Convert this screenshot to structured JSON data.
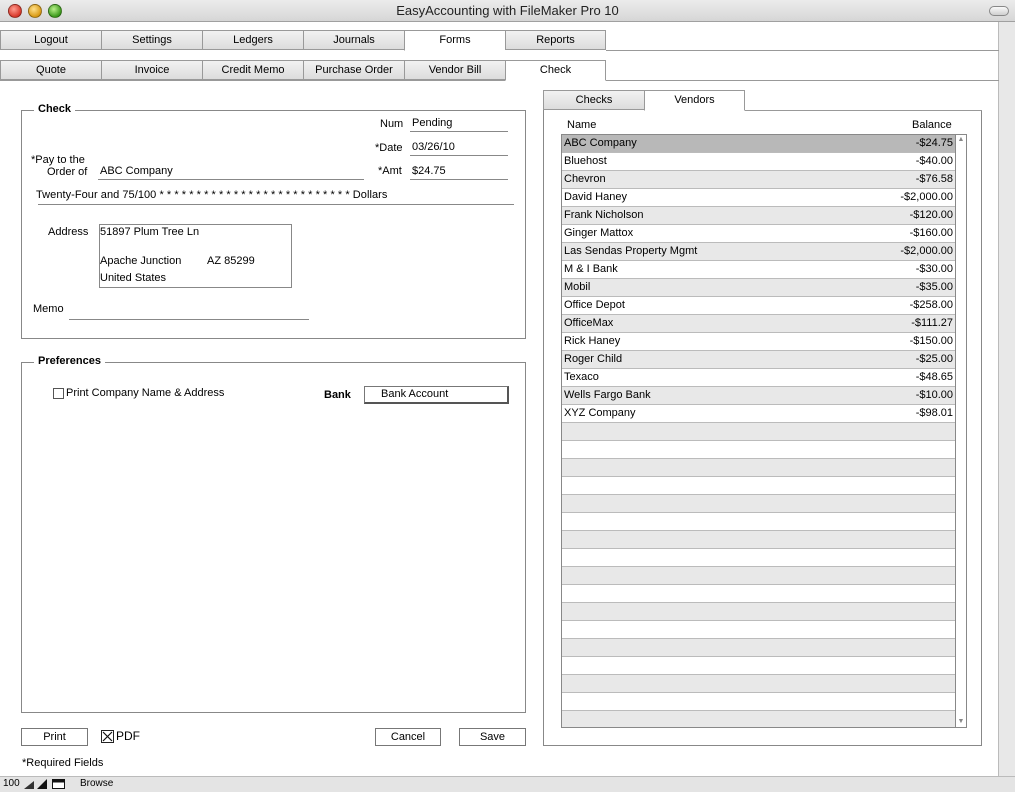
{
  "window": {
    "title": "EasyAccounting with FileMaker Pro 10"
  },
  "main_tabs": [
    "Logout",
    "Settings",
    "Ledgers",
    "Journals",
    "Forms",
    "Reports"
  ],
  "sub_tabs": [
    "Quote",
    "Invoice",
    "Credit Memo",
    "Purchase Order",
    "Vendor Bill",
    "Check"
  ],
  "check": {
    "legend": "Check",
    "num_label": "Num",
    "num_value": "Pending",
    "date_label": "*Date",
    "date_value": "03/26/10",
    "pay_to_label_1": "*Pay to the",
    "pay_to_label_2": "Order of",
    "pay_to_value": "ABC Company",
    "amt_label": "*Amt",
    "amt_value": "$24.75",
    "amount_words": "Twenty-Four and 75/100 * * * * * * * * * * * * * * * * * * * * * * * * * * Dollars",
    "address_label": "Address",
    "address_line1": "51897 Plum Tree Ln",
    "address_city": "Apache Junction",
    "address_state_zip": "AZ  85299",
    "address_country": "United States",
    "memo_label": "Memo"
  },
  "preferences": {
    "legend": "Preferences",
    "print_company_label": "Print Company Name & Address",
    "bank_label": "Bank",
    "bank_value": "Bank Account"
  },
  "bottom": {
    "print_label": "Print",
    "pdf_label": "PDF",
    "cancel_label": "Cancel",
    "save_label": "Save",
    "required_note": "*Required Fields"
  },
  "right_tabs": [
    "Checks",
    "Vendors"
  ],
  "vendors": {
    "name_header": "Name",
    "balance_header": "Balance",
    "rows": [
      {
        "name": "ABC Company",
        "balance": "-$24.75"
      },
      {
        "name": "Bluehost",
        "balance": "-$40.00"
      },
      {
        "name": "Chevron",
        "balance": "-$76.58"
      },
      {
        "name": "David Haney",
        "balance": "-$2,000.00"
      },
      {
        "name": "Frank Nicholson",
        "balance": "-$120.00"
      },
      {
        "name": "Ginger Mattox",
        "balance": "-$160.00"
      },
      {
        "name": "Las Sendas Property Mgmt",
        "balance": "-$2,000.00"
      },
      {
        "name": "M & I Bank",
        "balance": "-$30.00"
      },
      {
        "name": "Mobil",
        "balance": "-$35.00"
      },
      {
        "name": "Office Depot",
        "balance": "-$258.00"
      },
      {
        "name": "OfficeMax",
        "balance": "-$111.27"
      },
      {
        "name": "Rick Haney",
        "balance": "-$150.00"
      },
      {
        "name": "Roger Child",
        "balance": "-$25.00"
      },
      {
        "name": "Texaco",
        "balance": "-$48.65"
      },
      {
        "name": "Wells Fargo Bank",
        "balance": "-$10.00"
      },
      {
        "name": "XYZ Company",
        "balance": "-$98.01"
      }
    ]
  },
  "statusbar": {
    "zoom": "100",
    "mode": "Browse"
  }
}
